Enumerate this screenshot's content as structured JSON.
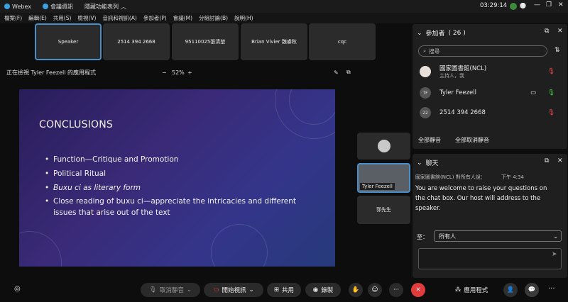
{
  "titlebar": {
    "app": "Webex",
    "meeting_info": "會議資訊",
    "hide_menu": "隱藏功能表列",
    "clock": "03:29:14"
  },
  "menu": [
    "檔案(F)",
    "編輯(E)",
    "共用(S)",
    "檢視(V)",
    "音訊和視訊(A)",
    "參加者(P)",
    "會議(M)",
    "分組討論(B)",
    "說明(H)"
  ],
  "tiles": [
    "Speaker",
    "2514 394 2668",
    "95110025張清堃",
    "Brian Vivier 魏睿秋",
    "cqc"
  ],
  "share": {
    "viewing": "正在檢視 Tyler Feezell 的應用程式",
    "zoom": "52%",
    "minus": "−",
    "plus": "+"
  },
  "slide": {
    "title": "CONCLUSIONS",
    "bullets": [
      "Function—Critique and Promotion",
      "Political Ritual",
      "Buxu ci as literary form",
      "Close reading of buxu ci—appreciate the intricacies and different issues that arise out of the text"
    ]
  },
  "thumbs": {
    "tyler": "Tyler Feezell",
    "guo": "郭先生"
  },
  "participants": {
    "title": "參加者",
    "count": "( 26 )",
    "search_placeholder": "搜尋",
    "rows": [
      {
        "name": "國家圖書館(NCL)",
        "sub": "主持人，我"
      },
      {
        "name": "Tyler Feezell",
        "sub": ""
      },
      {
        "name": "2514 394 2668",
        "sub": "",
        "avatar": "22"
      }
    ],
    "mute_all": "全部靜音",
    "unmute_all": "全部取消靜音"
  },
  "chat": {
    "title": "聊天",
    "sender": "國家圖書館(NCL) 對所有人說：",
    "time": "下午 4:34",
    "message": "You are welcome to raise your questions on the chat box. Our host will address to the speaker.",
    "to_label": "至：",
    "to_value": "所有人"
  },
  "bottom": {
    "unmute": "取消靜音",
    "start_video": "開始視訊",
    "share": "共用",
    "record": "錄製",
    "more": "···",
    "apps": "應用程式"
  },
  "colors": {
    "accent": "#4a90c8",
    "end_call": "#e23b3b",
    "slide_bg": "#3a2a78"
  }
}
